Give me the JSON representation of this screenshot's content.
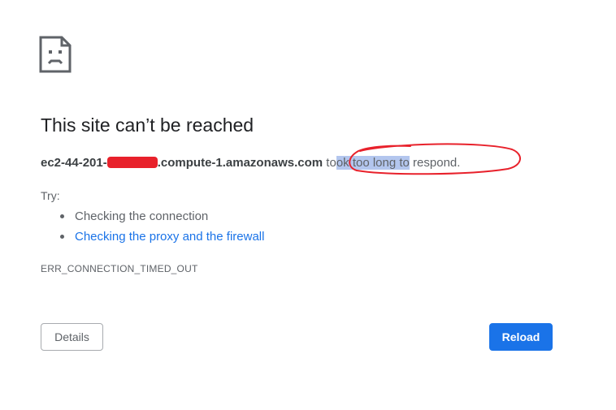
{
  "error": {
    "title": "This site can’t be reached",
    "host_prefix": "ec2-44-201-",
    "host_suffix": ".compute-1.amazonaws.com",
    "message_start": " to",
    "message_highlight": "ok too long to",
    "message_end": " respond.",
    "try_label": "Try:",
    "suggestions": [
      "Checking the connection",
      "Checking the proxy and the firewall"
    ],
    "error_code": "ERR_CONNECTION_TIMED_OUT"
  },
  "buttons": {
    "details_label": "Details",
    "reload_label": "Reload"
  },
  "icons": {
    "page_icon": "sad-page-icon"
  },
  "colors": {
    "link": "#1a73e8",
    "reload_button": "#1a73e8",
    "annotation": "#e8212b",
    "redaction": "#e8212b",
    "text_highlight": "#b3c6ee"
  }
}
